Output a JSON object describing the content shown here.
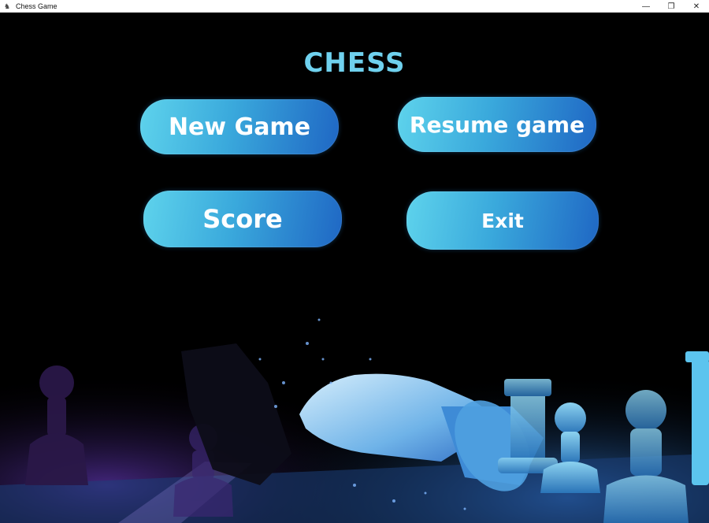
{
  "window": {
    "title": "Chess Game",
    "icon": "chess-app-icon",
    "controls": {
      "minimize": "—",
      "restore": "❐",
      "close": "✕"
    }
  },
  "logo": {
    "text": "CHESS"
  },
  "menu": {
    "new_game": "New Game",
    "resume_game": "Resume game",
    "score": "Score",
    "exit": "Exit"
  },
  "colors": {
    "accent": "#6fd1ee",
    "button_start": "#5ed3ec",
    "button_end": "#1f67c4",
    "background": "#000000"
  }
}
